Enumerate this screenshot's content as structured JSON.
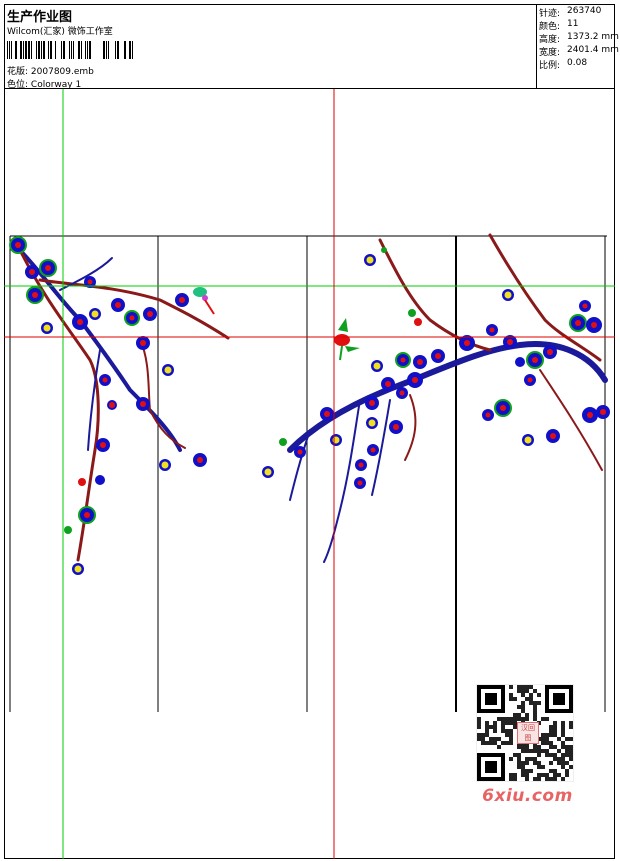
{
  "header": {
    "title": "生产作业图",
    "studio": "Wilcom(汇家) 微饰工作室",
    "design_label": "花版:",
    "design_value": "2007809.emb",
    "color_label": "色位:",
    "color_value": "Colorway 1"
  },
  "stats": [
    {
      "label": "针迹:",
      "value": "263740"
    },
    {
      "label": "颜色:",
      "value": "11"
    },
    {
      "label": "高度:",
      "value": "1373.2 mm"
    },
    {
      "label": "宽度:",
      "value": "2401.4 mm"
    },
    {
      "label": "比例:",
      "value": "0.08"
    }
  ],
  "watermark": {
    "text": "6xiu.com",
    "seal_text": "汉回图"
  },
  "colors": {
    "branch_dark": "#1a1a9a",
    "branch_brown": "#8a1a1a",
    "petal_blue": "#1010c8",
    "center_red": "#e01010",
    "leaf_green": "#10a020",
    "bud_yellow": "#f0e020",
    "guide_green": "#00cc00",
    "guide_red": "#dd0000",
    "watermark_red": "#e86464"
  }
}
